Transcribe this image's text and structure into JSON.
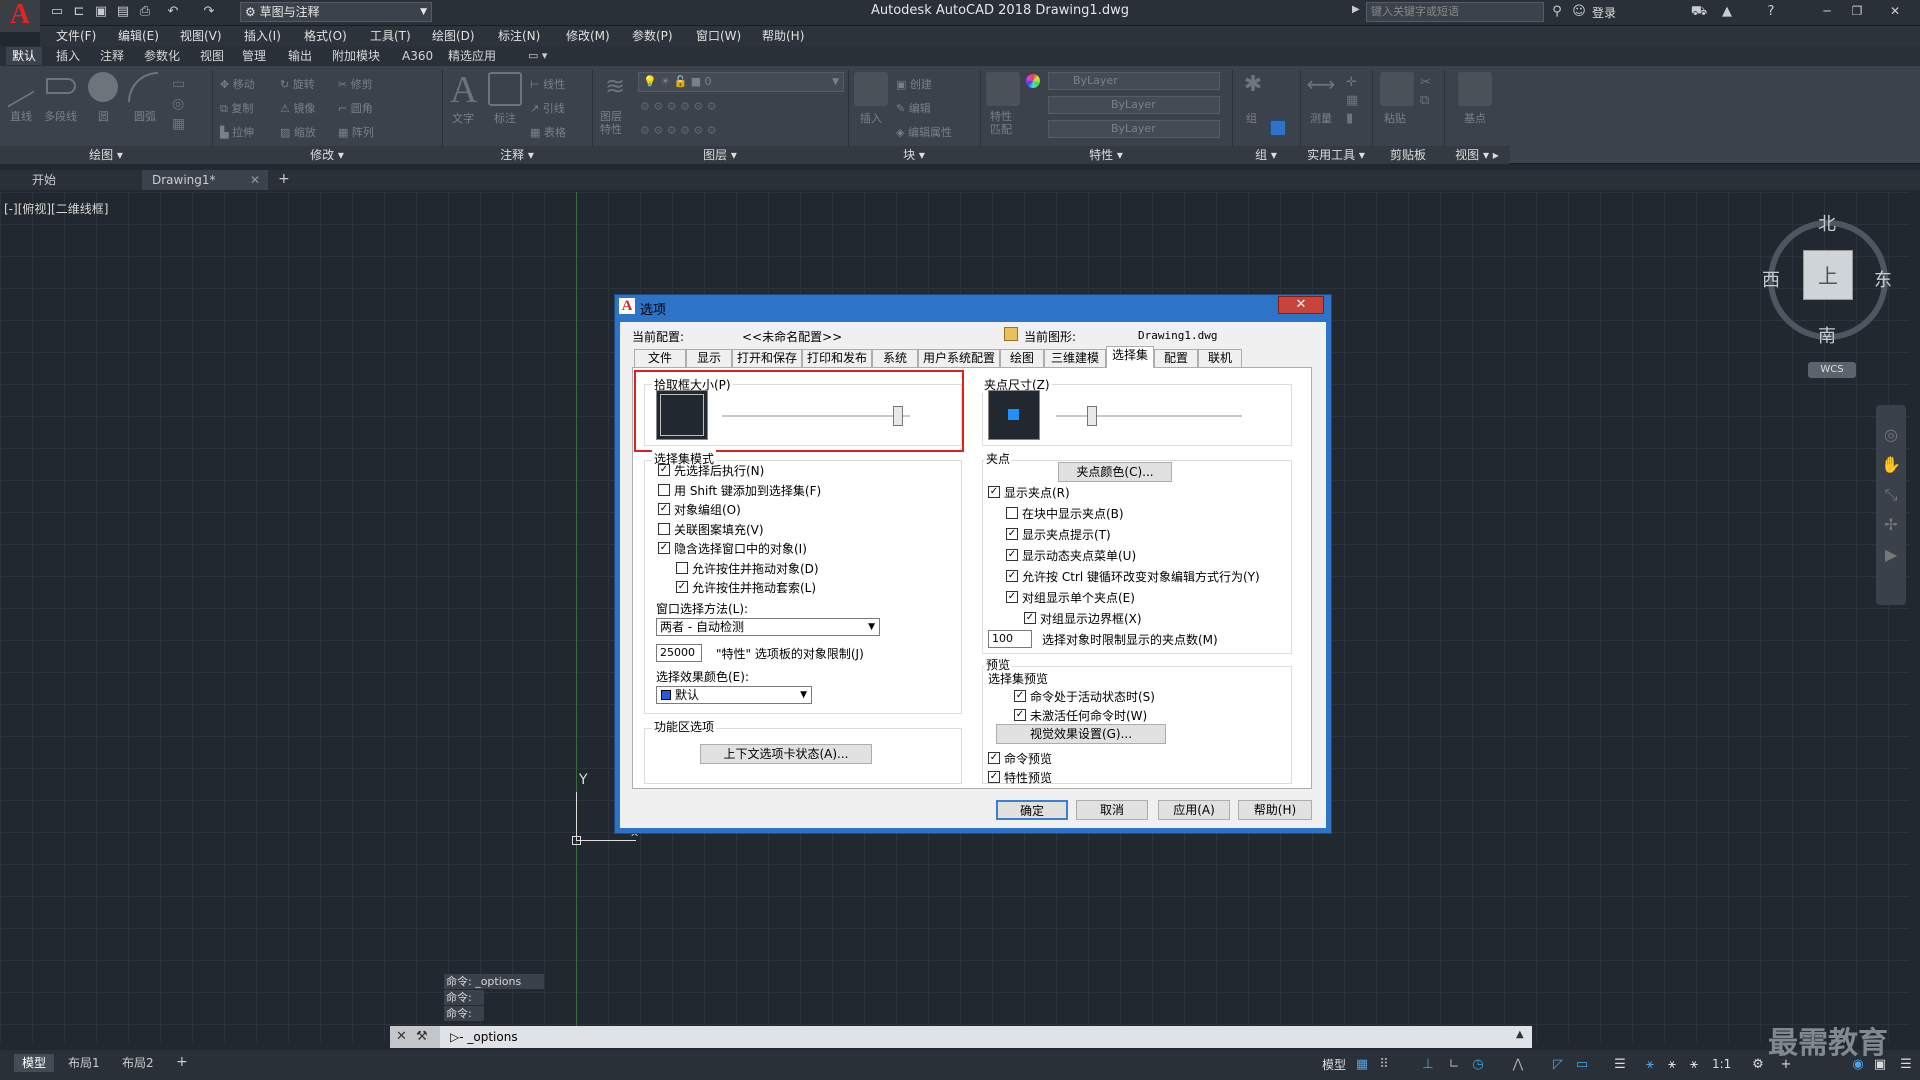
{
  "app": {
    "title": "Autodesk AutoCAD 2018    Drawing1.dwg",
    "workspace": "草图与注释",
    "search_placeholder": "键入关键字或短语",
    "login": "登录",
    "logo": "A"
  },
  "menu": [
    "文件(F)",
    "编辑(E)",
    "视图(V)",
    "插入(I)",
    "格式(O)",
    "工具(T)",
    "绘图(D)",
    "标注(N)",
    "修改(M)",
    "参数(P)",
    "窗口(W)",
    "帮助(H)"
  ],
  "ribbon_tabs": [
    "默认",
    "插入",
    "注释",
    "参数化",
    "视图",
    "管理",
    "输出",
    "附加模块",
    "A360",
    "精选应用"
  ],
  "ribbon_panels": [
    "绘图 ▾",
    "修改 ▾",
    "注释 ▾",
    "图层 ▾",
    "块 ▾",
    "特性 ▾",
    "组 ▾",
    "实用工具 ▾",
    "剪贴板",
    "视图 ▾ ▸"
  ],
  "ribbon_items": {
    "draw": [
      "直线",
      "多段线",
      "圆",
      "圆弧"
    ],
    "modify": [
      "移动",
      "旋转",
      "修剪",
      "复制",
      "镜像",
      "圆角",
      "拉伸",
      "缩放",
      "阵列"
    ],
    "annotation": [
      "文字",
      "标注",
      "线性",
      "引线",
      "表格"
    ],
    "layer": [
      "图层特性",
      "0"
    ],
    "block": [
      "插入",
      "创建",
      "编辑",
      "编辑属性"
    ],
    "properties": [
      "ByLayer",
      "ByLayer",
      "ByLayer",
      "特性匹配"
    ],
    "group": [
      "组"
    ],
    "utilities": [
      "测量"
    ],
    "clipboard": [
      "粘贴"
    ],
    "view": [
      "基点"
    ]
  },
  "file_tabs": [
    "开始",
    "Drawing1*"
  ],
  "viewport_label": "[-][俯视][二维线框]",
  "viewcube": {
    "north": "北",
    "south": "南",
    "east": "东",
    "west": "西",
    "top": "上",
    "wcs": "WCS"
  },
  "ucs": {
    "y": "Y"
  },
  "dialog": {
    "title": "选项",
    "current_profile_label": "当前配置:",
    "current_profile_value": "<<未命名配置>>",
    "current_drawing_label": "当前图形:",
    "current_drawing_value": "Drawing1.dwg",
    "tabs": [
      "文件",
      "显示",
      "打开和保存",
      "打印和发布",
      "系统",
      "用户系统配置",
      "绘图",
      "三维建模",
      "选择集",
      "配置",
      "联机"
    ],
    "active_tab": "选择集",
    "pickbox_label": "拾取框大小(P)",
    "pickbox_size": 0.94,
    "grip_size_label": "夹点尺寸(Z)",
    "grip_size": 0.2,
    "selection_modes_label": "选择集模式",
    "selection_modes": [
      {
        "label": "先选择后执行(N)",
        "checked": true,
        "indent": 0
      },
      {
        "label": "用 Shift 键添加到选择集(F)",
        "checked": false,
        "indent": 0
      },
      {
        "label": "对象编组(O)",
        "checked": true,
        "indent": 0
      },
      {
        "label": "关联图案填充(V)",
        "checked": false,
        "indent": 0
      },
      {
        "label": "隐含选择窗口中的对象(I)",
        "checked": true,
        "indent": 0
      },
      {
        "label": "允许按住并拖动对象(D)",
        "checked": false,
        "indent": 1
      },
      {
        "label": "允许按住并拖动套索(L)",
        "checked": true,
        "indent": 1
      }
    ],
    "window_method_label": "窗口选择方法(L):",
    "window_method_value": "两者 - 自动检测",
    "props_limit_value": "25000",
    "props_limit_label": "\"特性\" 选项板的对象限制(J)",
    "effect_color_label": "选择效果颜色(E):",
    "effect_color_value": "默认",
    "ribbon_options_label": "功能区选项",
    "contextual_tab_button": "上下文选项卡状态(A)...",
    "grips_label": "夹点",
    "grip_color_button": "夹点颜色(C)...",
    "grips": [
      {
        "label": "显示夹点(R)",
        "checked": true,
        "indent": 0
      },
      {
        "label": "在块中显示夹点(B)",
        "checked": false,
        "indent": 1
      },
      {
        "label": "显示夹点提示(T)",
        "checked": true,
        "indent": 1
      },
      {
        "label": "显示动态夹点菜单(U)",
        "checked": true,
        "indent": 1
      },
      {
        "label": "允许按 Ctrl 键循环改变对象编辑方式行为(Y)",
        "checked": true,
        "indent": 1
      },
      {
        "label": "对组显示单个夹点(E)",
        "checked": true,
        "indent": 1
      },
      {
        "label": "对组显示边界框(X)",
        "checked": true,
        "indent": 2
      }
    ],
    "grip_limit_value": "100",
    "grip_limit_label": "选择对象时限制显示的夹点数(M)",
    "preview_label": "预览",
    "selection_preview_label": "选择集预览",
    "preview_options": [
      {
        "label": "命令处于活动状态时(S)",
        "checked": true,
        "indent": 1
      },
      {
        "label": "未激活任何命令时(W)",
        "checked": true,
        "indent": 1
      }
    ],
    "visual_effects_button": "视觉效果设置(G)...",
    "preview_options2": [
      {
        "label": "命令预览",
        "checked": true,
        "indent": 0
      },
      {
        "label": "特性预览",
        "checked": true,
        "indent": 0
      }
    ],
    "buttons": {
      "ok": "确定",
      "cancel": "取消",
      "apply": "应用(A)",
      "help": "帮助(H)"
    }
  },
  "command_history": [
    "命令: _options",
    "命令:",
    "命令:"
  ],
  "command_line": "_options",
  "status_tabs": [
    "模型",
    "布局1",
    "布局2"
  ],
  "status_right": {
    "model": "模型",
    "scale": "1:1"
  },
  "watermark": "最需教育",
  "colors": {
    "accent": "#2d74c9",
    "highlight": "#e02020",
    "background": "#212830"
  }
}
